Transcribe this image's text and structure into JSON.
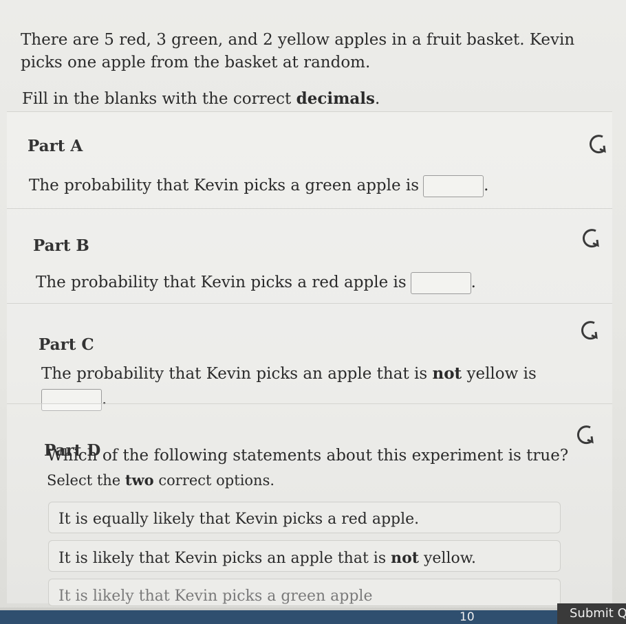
{
  "question": {
    "intro": "There are 5 red, 3 green, and 2 yellow apples in a fruit basket. Kevin picks one apple from the basket at random.",
    "instruction_prefix": "Fill in the blanks with the correct ",
    "instruction_bold": "decimals",
    "instruction_suffix": "."
  },
  "parts": [
    {
      "title": "Part A",
      "text": "The probability that Kevin picks a green apple is",
      "end": "."
    },
    {
      "title": "Part B",
      "text": "The probability that Kevin picks a red apple is",
      "end": "."
    },
    {
      "title": "Part C",
      "text_pre": "The probability that Kevin picks an apple that is ",
      "text_bold": "not",
      "text_post": " yellow is",
      "end": "."
    },
    {
      "title": "Part D",
      "text": "Which of the following statements about this experiment is true?",
      "select_pre": "Select the ",
      "select_bold": "two",
      "select_post": " correct options."
    }
  ],
  "options": [
    {
      "text": "It is equally likely that Kevin picks a red apple."
    },
    {
      "pre": "It is likely that Kevin picks an apple that is ",
      "bold": "not",
      "post": " yellow."
    },
    {
      "text": "It is likely that Kevin picks a green apple"
    }
  ],
  "footer": {
    "page_number": "10",
    "submit_label": "Submit Q"
  },
  "icons": {
    "reset": "reset-icon"
  }
}
